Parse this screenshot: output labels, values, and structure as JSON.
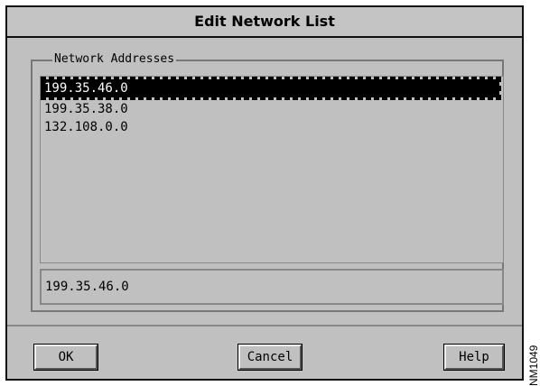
{
  "window": {
    "title": "Edit Network List"
  },
  "group": {
    "label": "Network Addresses"
  },
  "list": {
    "items": [
      {
        "label": "199.35.46.0",
        "selected": true
      },
      {
        "label": "199.35.38.0",
        "selected": false
      },
      {
        "label": "132.108.0.0",
        "selected": false
      }
    ]
  },
  "entry": {
    "value": "199.35.46.0"
  },
  "buttons": {
    "ok": "OK",
    "cancel": "Cancel",
    "help": "Help"
  },
  "figure_id": "NM1049",
  "colors": {
    "window_bg": "#c0c0c0",
    "selection_bg": "#000000",
    "selection_fg": "#ffffff"
  }
}
